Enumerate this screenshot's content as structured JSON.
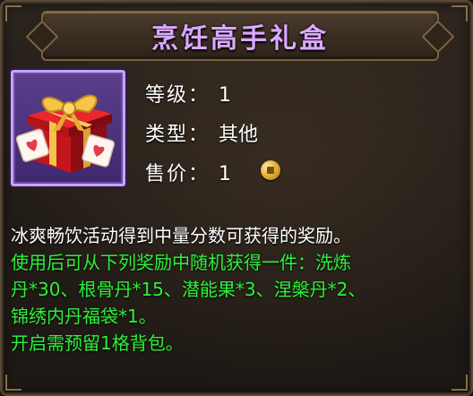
{
  "title": "烹饪高手礼盒",
  "item": {
    "icon": "gift-box-icon"
  },
  "stats": {
    "level_label": "等级：",
    "level_value": "1",
    "type_label": "类型：",
    "type_value": "其他",
    "price_label": "售价：",
    "price_value": "1",
    "currency_icon": "coin-icon"
  },
  "description": {
    "line1": "冰爽畅饮活动得到中量分数可获得的奖励。",
    "line2": "使用后可从下列奖励中随机获得一件：洗炼",
    "line3": "丹*30、根骨丹*15、潜能果*3、涅槃丹*2、",
    "line4": "锦绣内丹福袋*1。",
    "line5": "开启需预留1格背包。"
  },
  "colors": {
    "title": "#dba8ff",
    "desc_white": "#ffffff",
    "desc_green": "#2cf23a",
    "slot_border": "#c9a3ff"
  }
}
